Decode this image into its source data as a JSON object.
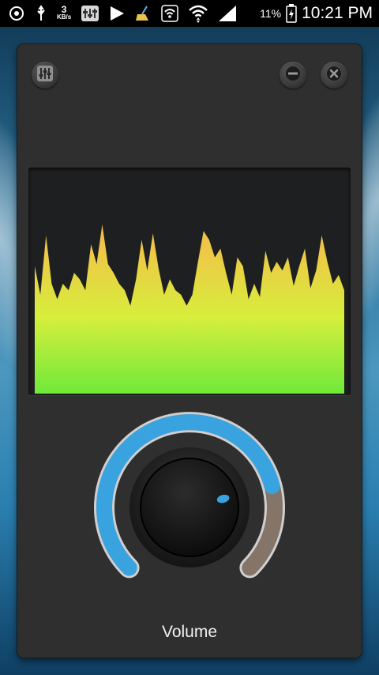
{
  "status_bar": {
    "network_speed_value": "3",
    "network_speed_unit": "KB/s",
    "battery_percent": "11%",
    "time": "10:21 PM",
    "icons": [
      "target-icon",
      "usb-icon",
      "network-speed-icon",
      "equalizer-app-icon",
      "play-icon",
      "cleaner-broom-icon",
      "wifi-icon",
      "wifi-transfer-icon",
      "signal-bars-icon",
      "battery-charging-icon"
    ]
  },
  "widget": {
    "buttons": {
      "equalizer": "equalizer-icon",
      "minimize": "minimize-icon",
      "close": "close-icon"
    },
    "spectrum_levels": [
      0.58,
      0.45,
      0.72,
      0.5,
      0.43,
      0.5,
      0.47,
      0.55,
      0.52,
      0.47,
      0.68,
      0.59,
      0.77,
      0.59,
      0.55,
      0.5,
      0.47,
      0.4,
      0.52,
      0.7,
      0.56,
      0.73,
      0.57,
      0.45,
      0.52,
      0.47,
      0.45,
      0.4,
      0.45,
      0.6,
      0.74,
      0.7,
      0.62,
      0.66,
      0.55,
      0.45,
      0.62,
      0.58,
      0.43,
      0.5,
      0.44,
      0.65,
      0.55,
      0.6,
      0.56,
      0.62,
      0.49,
      0.58,
      0.66,
      0.48,
      0.56,
      0.72,
      0.6,
      0.5,
      0.54,
      0.47
    ],
    "volume_level": 0.78,
    "volume_label": "Volume",
    "colors": {
      "panel": "#2f2f2f",
      "spectrum_top": "#f7b94a",
      "spectrum_bottom": "#6fe93a",
      "volume_arc": "#39a3e0",
      "volume_track": "#857468"
    }
  }
}
